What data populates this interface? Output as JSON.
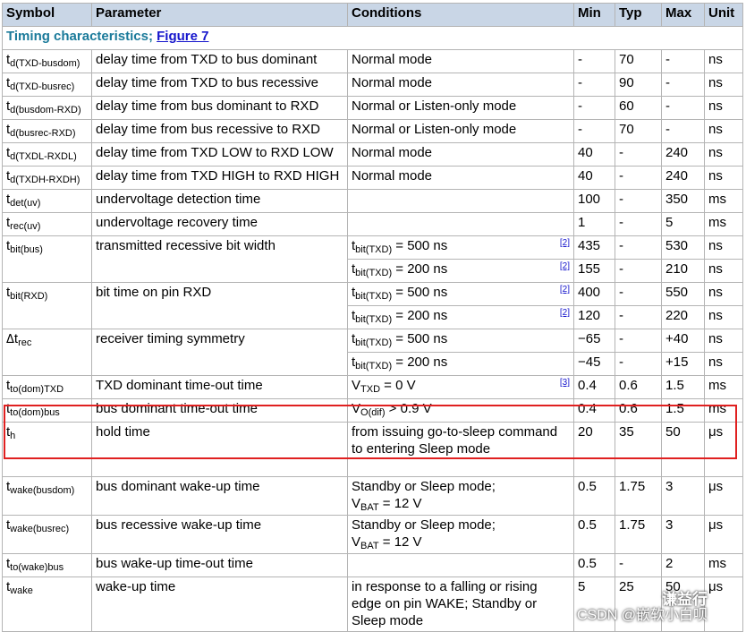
{
  "headers": {
    "symbol": "Symbol",
    "parameter": "Parameter",
    "conditions": "Conditions",
    "min": "Min",
    "typ": "Typ",
    "max": "Max",
    "unit": "Unit"
  },
  "section": {
    "title": "Timing characteristics; ",
    "link": "Figure 7"
  },
  "rows": [
    {
      "sym": "t",
      "sub": "d(TXD-busdom)",
      "param": "delay time from TXD to bus dominant",
      "cond": "Normal mode",
      "min": "-",
      "typ": "70",
      "max": "-",
      "unit": "ns"
    },
    {
      "sym": "t",
      "sub": "d(TXD-busrec)",
      "param": "delay time from TXD to bus recessive",
      "cond": "Normal mode",
      "min": "-",
      "typ": "90",
      "max": "-",
      "unit": "ns"
    },
    {
      "sym": "t",
      "sub": "d(busdom-RXD)",
      "param": "delay time from bus dominant to RXD",
      "cond": "Normal or Listen-only mode",
      "min": "-",
      "typ": "60",
      "max": "-",
      "unit": "ns"
    },
    {
      "sym": "t",
      "sub": "d(busrec-RXD)",
      "param": "delay time from bus recessive to RXD",
      "cond": "Normal or Listen-only mode",
      "min": "-",
      "typ": "70",
      "max": "-",
      "unit": "ns"
    },
    {
      "sym": "t",
      "sub": "d(TXDL-RXDL)",
      "param": "delay time from TXD LOW to RXD LOW",
      "cond": "Normal mode",
      "min": "40",
      "typ": "-",
      "max": "240",
      "unit": "ns"
    },
    {
      "sym": "t",
      "sub": "d(TXDH-RXDH)",
      "param": "delay time from TXD HIGH to RXD HIGH",
      "cond": "Normal mode",
      "min": "40",
      "typ": "-",
      "max": "240",
      "unit": "ns"
    },
    {
      "sym": "t",
      "sub": "det(uv)",
      "param": "undervoltage detection time",
      "cond": "",
      "min": "100",
      "typ": "-",
      "max": "350",
      "unit": "ms"
    },
    {
      "sym": "t",
      "sub": "rec(uv)",
      "param": "undervoltage recovery time",
      "cond": "",
      "min": "1",
      "typ": "-",
      "max": "5",
      "unit": "ms"
    }
  ],
  "bit_bus": {
    "sym": "t",
    "sub": "bit(bus)",
    "param": "transmitted recessive bit width",
    "c1": {
      "v": "t",
      "s": "bit(TXD)",
      "rest": " = 500 ns",
      "note": "[2]",
      "min": "435",
      "typ": "-",
      "max": "530",
      "unit": "ns"
    },
    "c2": {
      "v": "t",
      "s": "bit(TXD)",
      "rest": " = 200 ns",
      "note": "[2]",
      "min": "155",
      "typ": "-",
      "max": "210",
      "unit": "ns"
    }
  },
  "bit_rxd": {
    "sym": "t",
    "sub": "bit(RXD)",
    "param": "bit time on pin RXD",
    "c1": {
      "v": "t",
      "s": "bit(TXD)",
      "rest": " = 500 ns",
      "note": "[2]",
      "min": "400",
      "typ": "-",
      "max": "550",
      "unit": "ns"
    },
    "c2": {
      "v": "t",
      "s": "bit(TXD)",
      "rest": " = 200 ns",
      "note": "[2]",
      "min": "120",
      "typ": "-",
      "max": "220",
      "unit": "ns"
    }
  },
  "trec": {
    "delta": "Δ",
    "sym": "t",
    "sub": "rec",
    "param": "receiver timing symmetry",
    "c1": {
      "v": "t",
      "s": "bit(TXD)",
      "rest": " = 500 ns",
      "min": "−65",
      "typ": "-",
      "max": "+40",
      "unit": "ns"
    },
    "c2": {
      "v": "t",
      "s": "bit(TXD)",
      "rest": " = 200 ns",
      "min": "−45",
      "typ": "-",
      "max": "+15",
      "unit": "ns"
    }
  },
  "to_txd": {
    "sym": "t",
    "sub": "to(dom)TXD",
    "param": "TXD dominant time-out time",
    "cv": "V",
    "cs": "TXD",
    "crest": " = 0 V",
    "note": "[3]",
    "min": "0.4",
    "typ": "0.6",
    "max": "1.5",
    "unit": "ms"
  },
  "to_bus": {
    "sym": "t",
    "sub": "to(dom)bus",
    "param": "bus dominant time-out time",
    "cv": "V",
    "cs": "O(dif)",
    "crest": " > 0.9 V",
    "min": "0.4",
    "typ": "0.6",
    "max": "1.5",
    "unit": "ms"
  },
  "th": {
    "sym": "t",
    "sub": "h",
    "param": "hold time",
    "cond": "from issuing go-to-sleep command to entering Sleep mode",
    "min": "20",
    "typ": "35",
    "max": "50",
    "unit": "μs"
  },
  "wake_dom": {
    "sym": "t",
    "sub": "wake(busdom)",
    "param": "bus dominant wake-up time",
    "cond": "Standby or Sleep mode;",
    "cv": "V",
    "cs": "BAT",
    "crest": " = 12 V",
    "min": "0.5",
    "typ": "1.75",
    "max": "3",
    "unit": "μs"
  },
  "wake_rec": {
    "sym": "t",
    "sub": "wake(busrec)",
    "param": "bus recessive wake-up time",
    "cond": "Standby or Sleep mode;",
    "cv": "V",
    "cs": "BAT",
    "crest": " = 12 V",
    "min": "0.5",
    "typ": "1.75",
    "max": "3",
    "unit": "μs"
  },
  "to_wake": {
    "sym": "t",
    "sub": "to(wake)bus",
    "param": "bus wake-up time-out time",
    "cond": "",
    "min": "0.5",
    "typ": "-",
    "max": "2",
    "unit": "ms"
  },
  "twake": {
    "sym": "t",
    "sub": "wake",
    "param": "wake-up time",
    "cond": "in response to a falling or rising edge on pin WAKE; Standby or Sleep mode",
    "min": "5",
    "typ": "25",
    "max": "50",
    "unit": "μs"
  },
  "watermark": {
    "name": "谦益行",
    "text": "CSDN @嵌软小白呗"
  }
}
